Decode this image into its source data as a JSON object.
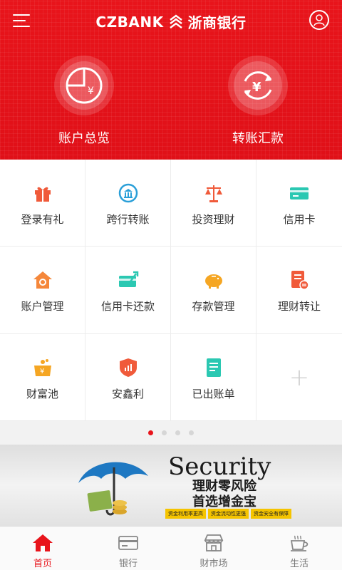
{
  "header": {
    "brand_en": "CZBANK",
    "brand_cn": "浙商银行"
  },
  "hero": [
    {
      "label": "账户总览",
      "icon": "account-overview-icon"
    },
    {
      "label": "转账汇款",
      "icon": "transfer-icon"
    }
  ],
  "grid": [
    {
      "label": "登录有礼",
      "icon": "gift-icon",
      "color": "#f05a3a"
    },
    {
      "label": "跨行转账",
      "icon": "bank-transfer-icon",
      "color": "#2a9fd8"
    },
    {
      "label": "投资理财",
      "icon": "scale-icon",
      "color": "#f05a3a"
    },
    {
      "label": "信用卡",
      "icon": "credit-card-icon",
      "color": "#2bc8b2"
    },
    {
      "label": "账户管理",
      "icon": "house-gear-icon",
      "color": "#f5873a"
    },
    {
      "label": "信用卡还款",
      "icon": "card-repay-icon",
      "color": "#2bc8b2"
    },
    {
      "label": "存款管理",
      "icon": "piggy-bank-icon",
      "color": "#f5a623"
    },
    {
      "label": "理财转让",
      "icon": "doc-transfer-icon",
      "color": "#f05a3a"
    },
    {
      "label": "财富池",
      "icon": "wealth-pool-icon",
      "color": "#f5a623"
    },
    {
      "label": "安鑫利",
      "icon": "shield-chart-icon",
      "color": "#f05a3a"
    },
    {
      "label": "已出账单",
      "icon": "bill-icon",
      "color": "#2bc8b2"
    }
  ],
  "pager": {
    "count": 4,
    "active": 0
  },
  "banner": {
    "title": "Security",
    "line1": "理财零风险",
    "line2": "首选增金宝",
    "tags": [
      "资金利用率更高",
      "资金流动性更强",
      "资金安全有保障"
    ]
  },
  "nav": [
    {
      "label": "首页",
      "icon": "home-icon",
      "active": true
    },
    {
      "label": "银行",
      "icon": "bank-card-icon",
      "active": false
    },
    {
      "label": "财市场",
      "icon": "market-icon",
      "active": false
    },
    {
      "label": "生活",
      "icon": "coffee-icon",
      "active": false
    }
  ],
  "colors": {
    "primary": "#e8141b",
    "nav_inactive": "#777777"
  }
}
